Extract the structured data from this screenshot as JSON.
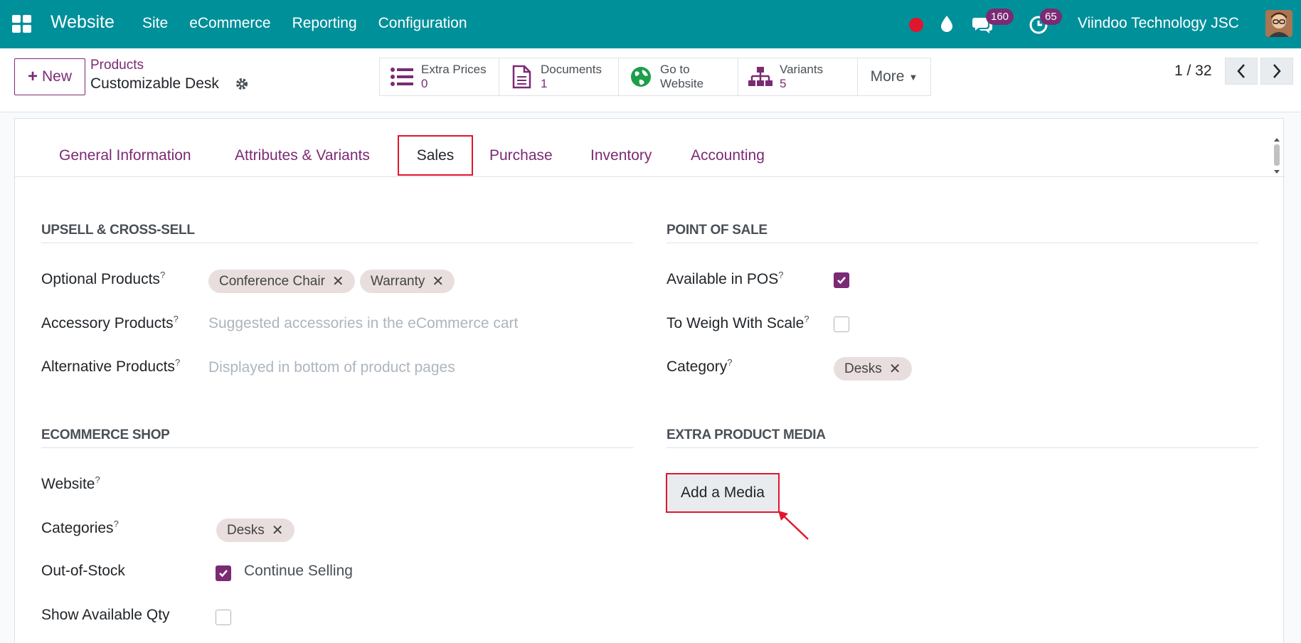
{
  "navbar": {
    "brand": "Website",
    "menu": [
      "Site",
      "eCommerce",
      "Reporting",
      "Configuration"
    ],
    "chat_count": "160",
    "activity_count": "65",
    "company": "Viindoo Technology JSC",
    "color": "#00909a"
  },
  "control": {
    "new_label": "New",
    "breadcrumb_parent": "Products",
    "breadcrumb_current": "Customizable Desk",
    "smart_buttons": [
      {
        "label": "Extra Prices",
        "value": "0",
        "icon": "list-icon"
      },
      {
        "label": "Documents",
        "value": "1",
        "icon": "document-icon"
      },
      {
        "label": "Go to",
        "value": "Website",
        "icon": "globe-icon"
      },
      {
        "label": "Variants",
        "value": "5",
        "icon": "sitemap-icon"
      }
    ],
    "more_label": "More",
    "pager": "1 / 32"
  },
  "tabs": {
    "general": "General Information",
    "attributes": "Attributes & Variants",
    "sales": "Sales",
    "purchase": "Purchase",
    "inventory": "Inventory",
    "accounting": "Accounting"
  },
  "upsell": {
    "title": "UPSELL & CROSS-SELL",
    "optional_label": "Optional Products",
    "optional_tags": [
      "Conference Chair",
      "Warranty"
    ],
    "accessory_label": "Accessory Products",
    "accessory_placeholder": "Suggested accessories in the eCommerce cart",
    "alternative_label": "Alternative Products",
    "alternative_placeholder": "Displayed in bottom of product pages"
  },
  "pos": {
    "title": "POINT OF SALE",
    "available_label": "Available in POS",
    "available_checked": true,
    "weigh_label": "To Weigh With Scale",
    "weigh_checked": false,
    "category_label": "Category",
    "category_tag": "Desks"
  },
  "ecommerce": {
    "title": "ECOMMERCE SHOP",
    "website_label": "Website",
    "categories_label": "Categories",
    "categories_tag": "Desks",
    "stock_label": "Out-of-Stock",
    "continue_selling_label": "Continue Selling",
    "continue_selling_checked": true,
    "show_qty_label": "Show Available Qty",
    "show_qty_checked": false
  },
  "media": {
    "title": "EXTRA PRODUCT MEDIA",
    "add_label": "Add a Media"
  },
  "help_mark": "?"
}
